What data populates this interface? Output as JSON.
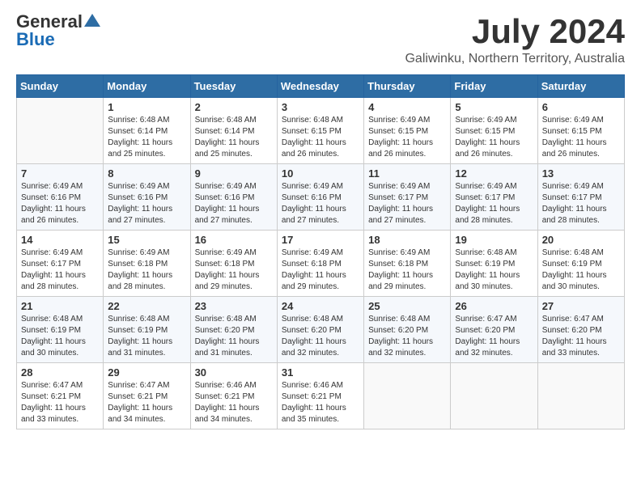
{
  "logo": {
    "general": "General",
    "blue": "Blue"
  },
  "title": "July 2024",
  "subtitle": "Galiwinku, Northern Territory, Australia",
  "calendar": {
    "headers": [
      "Sunday",
      "Monday",
      "Tuesday",
      "Wednesday",
      "Thursday",
      "Friday",
      "Saturday"
    ],
    "rows": [
      [
        {
          "day": "",
          "info": ""
        },
        {
          "day": "1",
          "info": "Sunrise: 6:48 AM\nSunset: 6:14 PM\nDaylight: 11 hours\nand 25 minutes."
        },
        {
          "day": "2",
          "info": "Sunrise: 6:48 AM\nSunset: 6:14 PM\nDaylight: 11 hours\nand 25 minutes."
        },
        {
          "day": "3",
          "info": "Sunrise: 6:48 AM\nSunset: 6:15 PM\nDaylight: 11 hours\nand 26 minutes."
        },
        {
          "day": "4",
          "info": "Sunrise: 6:49 AM\nSunset: 6:15 PM\nDaylight: 11 hours\nand 26 minutes."
        },
        {
          "day": "5",
          "info": "Sunrise: 6:49 AM\nSunset: 6:15 PM\nDaylight: 11 hours\nand 26 minutes."
        },
        {
          "day": "6",
          "info": "Sunrise: 6:49 AM\nSunset: 6:15 PM\nDaylight: 11 hours\nand 26 minutes."
        }
      ],
      [
        {
          "day": "7",
          "info": "Sunrise: 6:49 AM\nSunset: 6:16 PM\nDaylight: 11 hours\nand 26 minutes."
        },
        {
          "day": "8",
          "info": "Sunrise: 6:49 AM\nSunset: 6:16 PM\nDaylight: 11 hours\nand 27 minutes."
        },
        {
          "day": "9",
          "info": "Sunrise: 6:49 AM\nSunset: 6:16 PM\nDaylight: 11 hours\nand 27 minutes."
        },
        {
          "day": "10",
          "info": "Sunrise: 6:49 AM\nSunset: 6:16 PM\nDaylight: 11 hours\nand 27 minutes."
        },
        {
          "day": "11",
          "info": "Sunrise: 6:49 AM\nSunset: 6:17 PM\nDaylight: 11 hours\nand 27 minutes."
        },
        {
          "day": "12",
          "info": "Sunrise: 6:49 AM\nSunset: 6:17 PM\nDaylight: 11 hours\nand 28 minutes."
        },
        {
          "day": "13",
          "info": "Sunrise: 6:49 AM\nSunset: 6:17 PM\nDaylight: 11 hours\nand 28 minutes."
        }
      ],
      [
        {
          "day": "14",
          "info": "Sunrise: 6:49 AM\nSunset: 6:17 PM\nDaylight: 11 hours\nand 28 minutes."
        },
        {
          "day": "15",
          "info": "Sunrise: 6:49 AM\nSunset: 6:18 PM\nDaylight: 11 hours\nand 28 minutes."
        },
        {
          "day": "16",
          "info": "Sunrise: 6:49 AM\nSunset: 6:18 PM\nDaylight: 11 hours\nand 29 minutes."
        },
        {
          "day": "17",
          "info": "Sunrise: 6:49 AM\nSunset: 6:18 PM\nDaylight: 11 hours\nand 29 minutes."
        },
        {
          "day": "18",
          "info": "Sunrise: 6:49 AM\nSunset: 6:18 PM\nDaylight: 11 hours\nand 29 minutes."
        },
        {
          "day": "19",
          "info": "Sunrise: 6:48 AM\nSunset: 6:19 PM\nDaylight: 11 hours\nand 30 minutes."
        },
        {
          "day": "20",
          "info": "Sunrise: 6:48 AM\nSunset: 6:19 PM\nDaylight: 11 hours\nand 30 minutes."
        }
      ],
      [
        {
          "day": "21",
          "info": "Sunrise: 6:48 AM\nSunset: 6:19 PM\nDaylight: 11 hours\nand 30 minutes."
        },
        {
          "day": "22",
          "info": "Sunrise: 6:48 AM\nSunset: 6:19 PM\nDaylight: 11 hours\nand 31 minutes."
        },
        {
          "day": "23",
          "info": "Sunrise: 6:48 AM\nSunset: 6:20 PM\nDaylight: 11 hours\nand 31 minutes."
        },
        {
          "day": "24",
          "info": "Sunrise: 6:48 AM\nSunset: 6:20 PM\nDaylight: 11 hours\nand 32 minutes."
        },
        {
          "day": "25",
          "info": "Sunrise: 6:48 AM\nSunset: 6:20 PM\nDaylight: 11 hours\nand 32 minutes."
        },
        {
          "day": "26",
          "info": "Sunrise: 6:47 AM\nSunset: 6:20 PM\nDaylight: 11 hours\nand 32 minutes."
        },
        {
          "day": "27",
          "info": "Sunrise: 6:47 AM\nSunset: 6:20 PM\nDaylight: 11 hours\nand 33 minutes."
        }
      ],
      [
        {
          "day": "28",
          "info": "Sunrise: 6:47 AM\nSunset: 6:21 PM\nDaylight: 11 hours\nand 33 minutes."
        },
        {
          "day": "29",
          "info": "Sunrise: 6:47 AM\nSunset: 6:21 PM\nDaylight: 11 hours\nand 34 minutes."
        },
        {
          "day": "30",
          "info": "Sunrise: 6:46 AM\nSunset: 6:21 PM\nDaylight: 11 hours\nand 34 minutes."
        },
        {
          "day": "31",
          "info": "Sunrise: 6:46 AM\nSunset: 6:21 PM\nDaylight: 11 hours\nand 35 minutes."
        },
        {
          "day": "",
          "info": ""
        },
        {
          "day": "",
          "info": ""
        },
        {
          "day": "",
          "info": ""
        }
      ]
    ]
  }
}
